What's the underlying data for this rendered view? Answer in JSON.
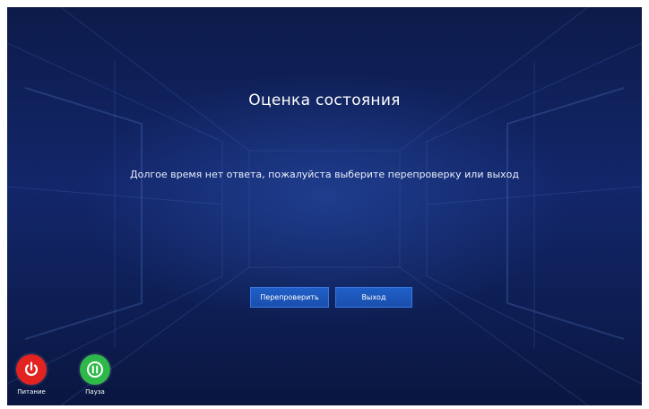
{
  "dialog": {
    "title": "Оценка состояния",
    "message": "Долгое время нет ответа, пожалуйста выберите перепроверку или выход"
  },
  "buttons": {
    "recheck_label": "Перепроверить",
    "exit_label": "Выход",
    "color": "#1a4fae"
  },
  "controls": {
    "power": {
      "label": "Питание",
      "icon": "power-icon",
      "color": "#e2231f"
    },
    "pause": {
      "label": "Пауза",
      "icon": "pause-icon",
      "color": "#2fb84a"
    }
  },
  "background_color": "#13266a"
}
